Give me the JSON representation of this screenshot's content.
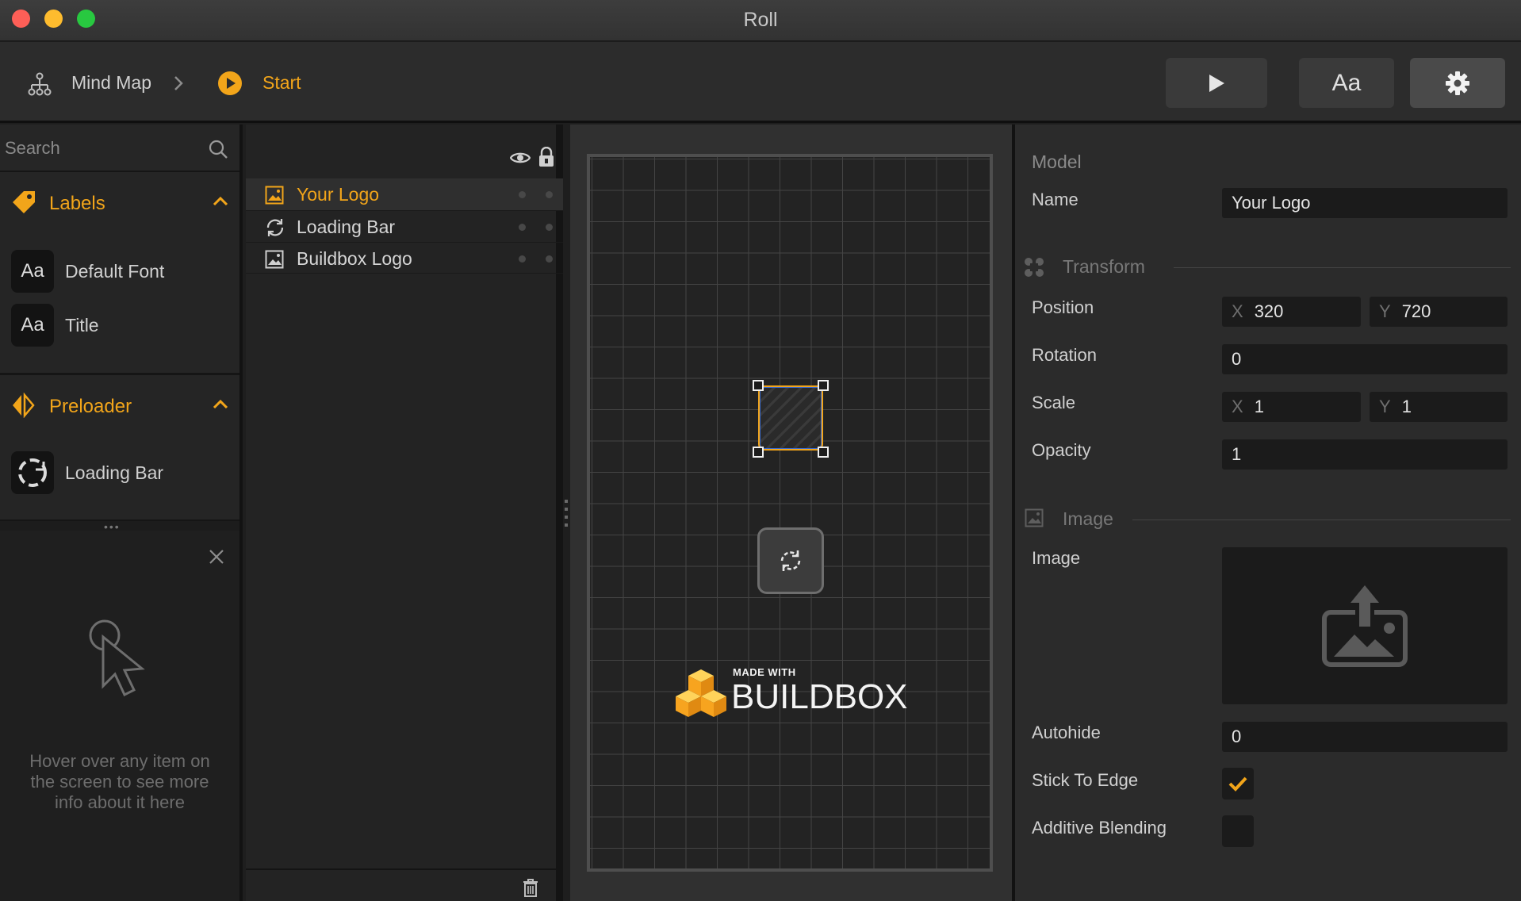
{
  "window": {
    "title": "Roll"
  },
  "toolbar": {
    "breadcrumbs": [
      {
        "label": "Mind Map",
        "icon": "mind-map-icon"
      },
      {
        "label": "Start",
        "icon": "play-circle-icon"
      }
    ],
    "play_icon": "play-icon",
    "font_button_label": "Aa",
    "settings_icon": "gear-icon",
    "accent_color": "#f2a51a"
  },
  "left_panel": {
    "search": {
      "placeholder": "Search"
    },
    "sections": [
      {
        "title": "Labels",
        "items": [
          {
            "label": "Default Font",
            "icon_text": "Aa"
          },
          {
            "label": "Title",
            "icon_text": "Aa"
          }
        ]
      },
      {
        "title": "Preloader",
        "items": [
          {
            "label": "Loading Bar"
          }
        ]
      }
    ],
    "hint": {
      "text": "Hover over any item on the screen to see more info about it here"
    }
  },
  "layers": {
    "items": [
      {
        "name": "Your Logo",
        "selected": true
      },
      {
        "name": "Loading Bar",
        "selected": false
      },
      {
        "name": "Buildbox Logo",
        "selected": false
      }
    ]
  },
  "canvas": {
    "logo": {
      "small_text": "MADE WITH",
      "big_text": "BUILDBOX"
    }
  },
  "properties": {
    "model_heading": "Model",
    "name_label": "Name",
    "name_value": "Your Logo",
    "transform_heading": "Transform",
    "position_label": "Position",
    "position_x": "320",
    "position_y": "720",
    "rotation_label": "Rotation",
    "rotation_value": "0",
    "scale_label": "Scale",
    "scale_x": "1",
    "scale_y": "1",
    "opacity_label": "Opacity",
    "opacity_value": "1",
    "image_heading": "Image",
    "image_label": "Image",
    "autohide_label": "Autohide",
    "autohide_value": "0",
    "stick_to_edge_label": "Stick To Edge",
    "stick_to_edge_checked": true,
    "additive_blending_label": "Additive Blending",
    "additive_blending_checked": false,
    "axis_x": "X",
    "axis_y": "Y"
  }
}
